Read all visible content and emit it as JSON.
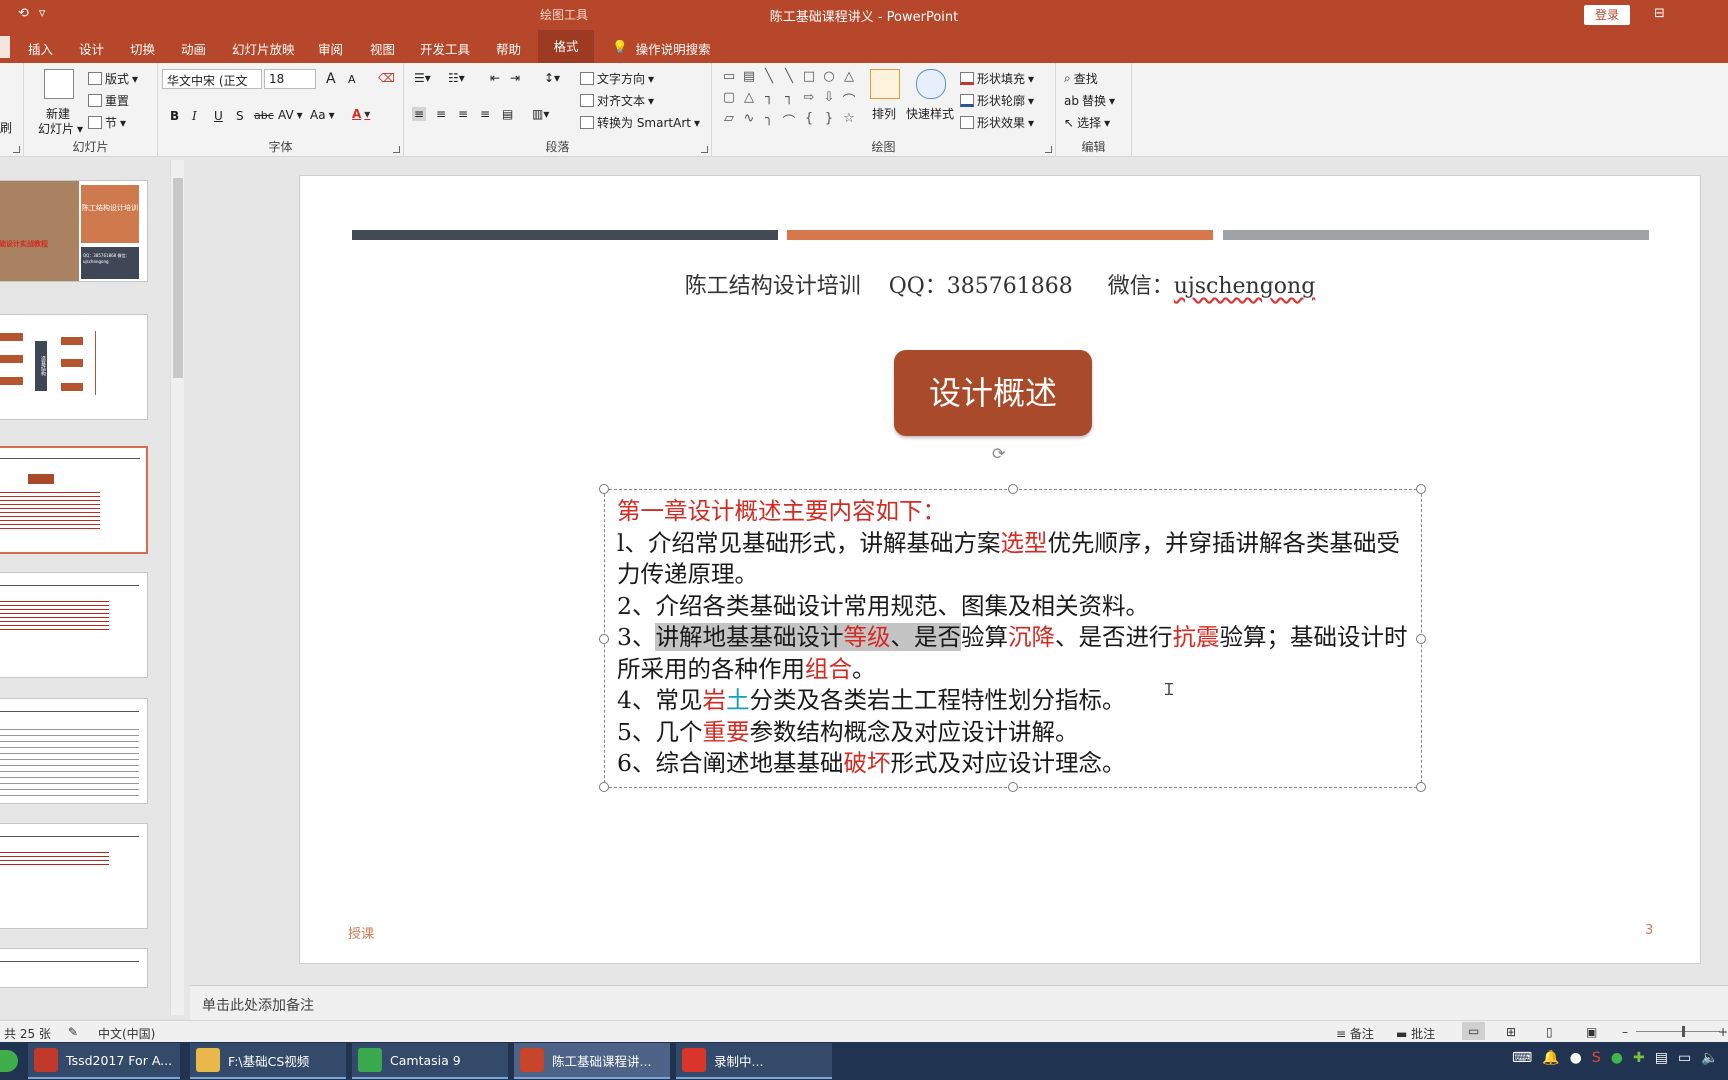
{
  "titlebar": {
    "quick_access": [
      "⟲",
      "▿"
    ],
    "context_tab": "绘图工具",
    "title": "陈工基础课程讲义  -  PowerPoint",
    "login": "登录",
    "ribbon_display_icon": "⊟"
  },
  "tabs": {
    "items": [
      "插入",
      "设计",
      "切换",
      "动画",
      "幻灯片放映",
      "审阅",
      "视图",
      "开发工具",
      "帮助"
    ],
    "active": "格式",
    "tell_me": "操作说明搜索",
    "tell_me_icon": "lightbulb-icon"
  },
  "ribbon": {
    "slides_group": {
      "label": "幻灯片",
      "new_slide_line1": "新建",
      "new_slide_line2": "幻灯片",
      "layout": "版式",
      "reset": "重置",
      "section": "节",
      "clipboard_stub": "刷"
    },
    "font_group": {
      "label": "字体",
      "font_name": "华文中宋 (正文",
      "font_size": "18",
      "grow": "A",
      "shrink": "A",
      "bold": "B",
      "italic": "I",
      "underline": "U",
      "shadow": "S",
      "strike": "abc",
      "spacing": "AV",
      "case": "Aa",
      "color": "A"
    },
    "paragraph_group": {
      "label": "段落",
      "text_direction": "文字方向",
      "align_text": "对齐文本",
      "smartart": "转换为 SmartArt"
    },
    "drawing_group": {
      "label": "绘图",
      "arrange": "排列",
      "quick_styles": "快速样式",
      "shape_fill": "形状填充",
      "shape_outline": "形状轮廓",
      "shape_effects": "形状效果",
      "shapes": [
        "▭",
        "▤",
        "╲",
        "╲",
        "□",
        "○",
        "△",
        "▢",
        "△",
        "┐",
        "┐",
        "⇨",
        "⇩",
        "⌒",
        "▱",
        "∿",
        "╮",
        "⌒",
        "{",
        "}",
        "☆"
      ]
    },
    "editing_group": {
      "label": "编辑",
      "find": "查找",
      "replace": "替换",
      "select": "选择"
    }
  },
  "thumbnails": {
    "thumb1_title": "陈工结构设计培训",
    "thumb1_contact": "QQ：385761868 微信：ujschengong",
    "thumb1_red": "础设计实战教程",
    "thumb2_center": "造基结构"
  },
  "slide": {
    "header_title": "陈工结构设计培训",
    "header_qq": "QQ：385761868",
    "header_wechat_label": "微信：",
    "header_wechat": "ujschengong",
    "title_box": "设计概述",
    "heading": "第一章设计概述主要内容如下：",
    "line1_a": "l、介绍常见基础形式，讲解基础方案",
    "line1_b": "选型",
    "line1_c": "优先顺序，并穿插讲解各类基础受力传递原理。",
    "line2": "2、介绍各类基础设计常用规范、图集及相关资料。",
    "line3_a": "3、",
    "line3_b": "讲解地基基础设计",
    "line3_c": "等级",
    "line3_d": "、是否",
    "line3_e": "验算",
    "line3_f": "沉降",
    "line3_g": "、是否进行",
    "line3_h": "抗震",
    "line3_i": "验算；基础设计时所采用的各种作用",
    "line3_j": "组合",
    "line3_k": "。",
    "line4_a": "4、常见",
    "line4_b": "岩",
    "line4_c": "土",
    "line4_d": "分类及各类岩土工程特性划分指标。",
    "line5_a": "5、几个",
    "line5_b": "重要",
    "line5_c": "参数结构概念及对应设计讲解。",
    "line6_a": "6、综合阐述地基基础",
    "line6_b": "破坏",
    "line6_c": "形式及对应设计理念。",
    "footer_left": "授课",
    "page_number": "3"
  },
  "notes": {
    "placeholder": "单击此处添加备注"
  },
  "statusbar": {
    "slide_count": "共 25 张",
    "language": "中文(中国)",
    "notes": "备注",
    "comments": "批注",
    "zoom_minus": "–",
    "zoom_plus": "+"
  },
  "taskbar": {
    "items": [
      {
        "label": "Tssd2017 For A...",
        "icon": "tssd-icon",
        "color": "#c0392b"
      },
      {
        "label": "F:\\基础CS视频",
        "icon": "folder-icon",
        "color": "#e8b84a"
      },
      {
        "label": "Camtasia 9",
        "icon": "camtasia-icon",
        "color": "#3aa84f"
      },
      {
        "label": "陈工基础课程讲...",
        "icon": "powerpoint-icon",
        "color": "#c8442a"
      },
      {
        "label": "录制中...",
        "icon": "recorder-icon",
        "color": "#d9352b"
      }
    ]
  },
  "colors": {
    "accent": "#b7472a",
    "stripe_dark": "#444a54",
    "stripe_orange": "#d7784c",
    "stripe_gray": "#9ea4a8",
    "title_box": "#a94b2a",
    "emphasis_red": "#d42a22",
    "emphasis_teal": "#14a0b8"
  }
}
